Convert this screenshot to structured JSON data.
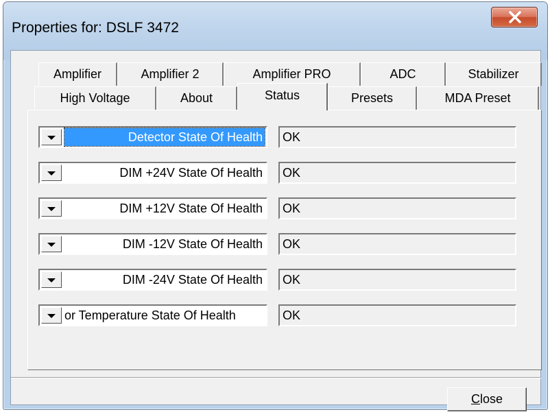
{
  "window": {
    "title": "Properties for: DSLF 3472"
  },
  "tabs": {
    "row1": [
      "Amplifier",
      "Amplifier 2",
      "Amplifier PRO",
      "ADC",
      "Stabilizer"
    ],
    "row2": [
      "High Voltage",
      "About",
      "Status",
      "Presets",
      "MDA Preset"
    ],
    "selected": "Status"
  },
  "status_rows": [
    {
      "label": "Detector State Of Health",
      "value": "OK"
    },
    {
      "label": "DIM +24V State Of Health",
      "value": "OK"
    },
    {
      "label": "DIM +12V State Of Health",
      "value": "OK"
    },
    {
      "label": "DIM -12V State Of Health",
      "value": "OK"
    },
    {
      "label": "DIM -24V State Of Health",
      "value": "OK"
    },
    {
      "label": "or Temperature State Of Health",
      "value": "OK"
    }
  ],
  "buttons": {
    "close_mnemonic": "C",
    "close_rest": "lose"
  },
  "colors": {
    "selection": "#3399ff",
    "title_close": "#c54b2c"
  }
}
